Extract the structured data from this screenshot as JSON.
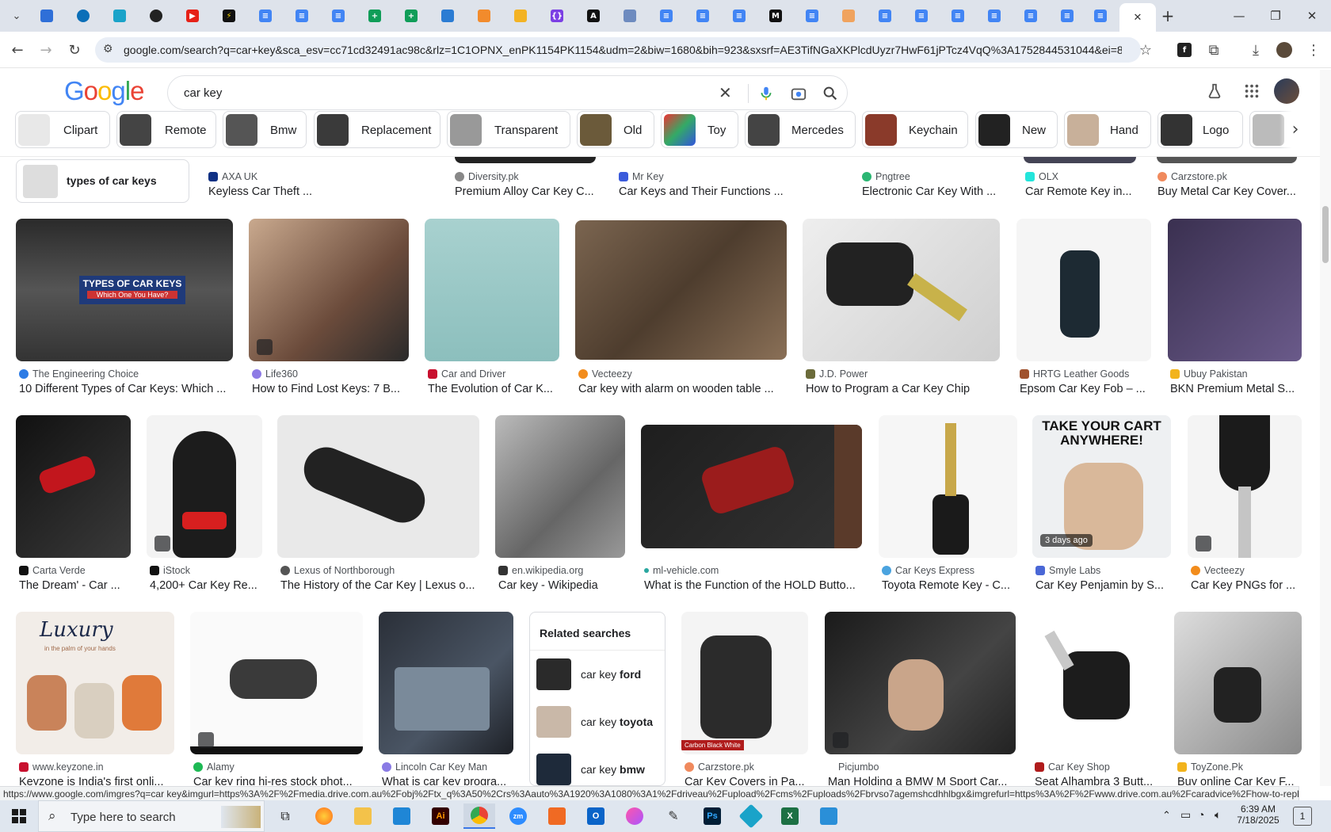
{
  "browser": {
    "url": "google.com/search?q=car+key&sca_esv=cc71cd32491ac98c&rlz=1C1OPNX_enPK1154PK1154&udm=2&biw=1680&bih=923&sxsrf=AE3TifNGaXKPlcdUyzr7HwF61jPTcz4VqQ%3A1752844531044&ei=80h...",
    "new_tab": "+",
    "close_tab": "✕"
  },
  "google": {
    "logo": "Google",
    "query": "car key"
  },
  "chips": [
    "Clipart",
    "Remote",
    "Bmw",
    "Replacement",
    "Transparent",
    "Old",
    "Toy",
    "Mercedes",
    "Keychain",
    "New",
    "Hand",
    "Logo"
  ],
  "row0": {
    "related_label": "types of car keys",
    "items": [
      {
        "source": "AXA UK",
        "title": "Keyless Car Theft ..."
      },
      {
        "source": "Diversity.pk",
        "title": "Premium Alloy Car Key C..."
      },
      {
        "source": "Mr Key",
        "title": "Car Keys and Their Functions ..."
      },
      {
        "source": "Pngtree",
        "title": "Electronic Car Key With ..."
      },
      {
        "source": "OLX",
        "title": "Car Remote Key in..."
      },
      {
        "source": "Carzstore.pk",
        "title": "Buy Metal Car Key Cover..."
      }
    ]
  },
  "row1": [
    {
      "source": "The Engineering Choice",
      "title": "10 Different Types of Car Keys: Which ...",
      "overlay1": "TYPES OF CAR KEYS",
      "overlay2": "Which One You Have?"
    },
    {
      "source": "Life360",
      "title": "How to Find Lost Keys: 7 B..."
    },
    {
      "source": "Car and Driver",
      "title": "The Evolution of Car K..."
    },
    {
      "source": "Vecteezy",
      "title": "Car key with alarm on wooden table ..."
    },
    {
      "source": "J.D. Power",
      "title": "How to Program a Car Key Chip"
    },
    {
      "source": "HRTG Leather Goods",
      "title": "Epsom Car Key Fob – ..."
    },
    {
      "source": "Ubuy Pakistan",
      "title": "BKN Premium Metal S..."
    }
  ],
  "row2": [
    {
      "source": "Carta Verde",
      "title": "The Dream' - Car ..."
    },
    {
      "source": "iStock",
      "title": "4,200+ Car Key Re..."
    },
    {
      "source": "Lexus of Northborough",
      "title": "The History of the Car Key | Lexus o..."
    },
    {
      "source": "en.wikipedia.org",
      "title": "Car key - Wikipedia"
    },
    {
      "source": "ml-vehicle.com",
      "title": "What is the Function of the HOLD Butto..."
    },
    {
      "source": "Car Keys Express",
      "title": "Toyota Remote Key - C..."
    },
    {
      "source": "Smyle Labs",
      "title": "Car Key Penjamin by S...",
      "overlay1": "TAKE YOUR CART",
      "overlay2": "ANYWHERE!",
      "age": "3 days ago"
    },
    {
      "source": "Vecteezy",
      "title": "Car Key PNGs for ..."
    }
  ],
  "row3": [
    {
      "source": "www.keyzone.in",
      "title": "Keyzone is India's first onli...",
      "overlay": "Luxury",
      "overlay_sub": "in the palm of your hands"
    },
    {
      "source": "Alamy",
      "title": "Car key ring hi-res stock phot..."
    },
    {
      "source": "Lincoln Car Key Man",
      "title": "What is car key progra..."
    },
    {
      "source": "Carzstore.pk",
      "title": "Car Key Covers in Pa...",
      "overlay": "Carbon Black White"
    },
    {
      "source": "Picjumbo",
      "title": "Man Holding a BMW M Sport Car..."
    },
    {
      "source": "Car Key Shop",
      "title": "Seat Alhambra 3 Butt..."
    },
    {
      "source": "ToyZone.Pk",
      "title": "Buy online Car Key F..."
    }
  ],
  "related": {
    "title": "Related searches",
    "items": [
      {
        "prefix": "car key ",
        "bold": "ford"
      },
      {
        "prefix": "car key ",
        "bold": "toyota"
      },
      {
        "prefix": "car key ",
        "bold": "bmw"
      }
    ]
  },
  "status_url": "https://www.google.com/imgres?q=car key&imgurl=https%3A%2F%2Fmedia.drive.com.au%2Fobj%2Ftx_q%3A50%2Crs%3Aauto%3A1920%3A1080%3A1%2Fdriveau%2Fupload%2Fcms%2Fuploads%2Fbrvso7agemshcdhhlbgx&imgrefurl=https%3A%2F%2Fwww.drive.com.au%2Fcaradvice%2Fhow-to-replace-...",
  "taskbar": {
    "search_placeholder": "Type here to search",
    "time": "6:39 AM",
    "date": "7/18/2025",
    "notifications": "1"
  }
}
